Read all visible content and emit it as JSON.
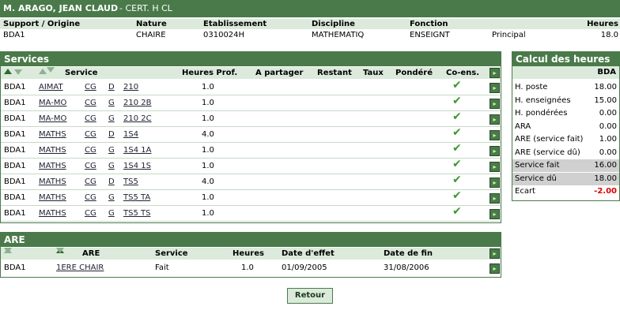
{
  "header": {
    "name": "M. ARAGO, JEAN CLAUD",
    "cert": "- CERT. H CL"
  },
  "info": {
    "headers": [
      "Support / Origine",
      "Nature",
      "Etablissement",
      "Discipline",
      "Fonction",
      "",
      "Heures"
    ],
    "values": [
      "BDA1",
      "CHAIRE",
      "0310024H",
      "MATHEMATIQ",
      "ENSEIGNT",
      "Principal",
      "18.0"
    ]
  },
  "services": {
    "title": "Services",
    "columns": [
      "Service",
      "Heures Prof.",
      "A partager",
      "Restant",
      "Taux",
      "Pondéré",
      "Co-ens."
    ],
    "rows": [
      {
        "origin": "BDA1",
        "service": "AIMAT",
        "cg": "CG",
        "l": "D",
        "class": "210",
        "hours": "1.0"
      },
      {
        "origin": "BDA1",
        "service": "MA-MO",
        "cg": "CG",
        "l": "G",
        "class": "210 2B",
        "hours": "1.0"
      },
      {
        "origin": "BDA1",
        "service": "MA-MO",
        "cg": "CG",
        "l": "G",
        "class": "210 2C",
        "hours": "1.0"
      },
      {
        "origin": "BDA1",
        "service": "MATHS",
        "cg": "CG",
        "l": "D",
        "class": "1S4",
        "hours": "4.0"
      },
      {
        "origin": "BDA1",
        "service": "MATHS",
        "cg": "CG",
        "l": "G",
        "class": "1S4 1A",
        "hours": "1.0"
      },
      {
        "origin": "BDA1",
        "service": "MATHS",
        "cg": "CG",
        "l": "G",
        "class": "1S4 1S",
        "hours": "1.0"
      },
      {
        "origin": "BDA1",
        "service": "MATHS",
        "cg": "CG",
        "l": "D",
        "class": "TS5",
        "hours": "4.0"
      },
      {
        "origin": "BDA1",
        "service": "MATHS",
        "cg": "CG",
        "l": "G",
        "class": "TS5 TA",
        "hours": "1.0"
      },
      {
        "origin": "BDA1",
        "service": "MATHS",
        "cg": "CG",
        "l": "G",
        "class": "TS5 TS",
        "hours": "1.0"
      }
    ]
  },
  "are": {
    "title": "ARE",
    "columns": [
      "ARE",
      "Service",
      "Heures",
      "Date d'effet",
      "Date de fin"
    ],
    "row": {
      "origin": "BDA1",
      "are": "1ERE CHAIR",
      "service": "Fait",
      "hours": "1.0",
      "start": "01/09/2005",
      "end": "31/08/2006"
    }
  },
  "calc": {
    "title": "Calcul des heures",
    "col": "BDA",
    "items": [
      {
        "label": "H. poste",
        "value": "18.00"
      },
      {
        "label": "H. enseignées",
        "value": "15.00"
      },
      {
        "label": "H. pondérées",
        "value": "0.00"
      },
      {
        "label": "ARA",
        "value": "0.00"
      },
      {
        "label": "ARE (service fait)",
        "value": "1.00"
      },
      {
        "label": "ARE (service dû)",
        "value": "0.00"
      },
      {
        "label": "Service fait",
        "value": "16.00"
      },
      {
        "label": "Service dû",
        "value": "18.00"
      },
      {
        "label": "Ecart",
        "value": "-2.00"
      }
    ]
  },
  "buttons": {
    "back": "Retour"
  },
  "colors": {
    "header_bg": "#4a7a4a",
    "subheader_bg": "#dbeadb",
    "accent_red": "#dd0000"
  }
}
